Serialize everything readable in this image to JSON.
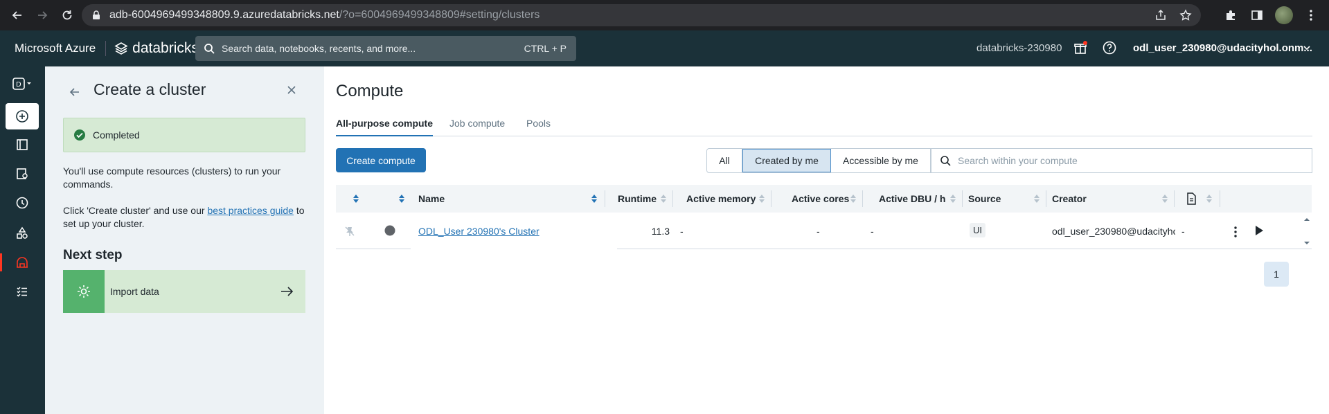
{
  "browser": {
    "url_host": "adb-6004969499348809.9.azuredatabricks.net",
    "url_rest": "/?o=6004969499348809#setting/clusters"
  },
  "topnav": {
    "brand": "Microsoft Azure",
    "product": "databricks",
    "search_placeholder": "Search data, notebooks, recents, and more...",
    "search_shortcut": "CTRL + P",
    "workspace": "databricks-230980",
    "user": "odl_user_230980@udacityhol.onm..."
  },
  "panel": {
    "title": "Create a cluster",
    "status": "Completed",
    "text1": "You'll use compute resources (clusters) to run your commands.",
    "text2_pre": "Click 'Create cluster' and use our ",
    "text2_link": "best practices guide",
    "text2_post": " to set up your cluster.",
    "next_step": "Next step",
    "import_label": "Import data"
  },
  "main": {
    "title": "Compute",
    "tabs": [
      "All-purpose compute",
      "Job compute",
      "Pools"
    ],
    "create_button": "Create compute",
    "filters": [
      "All",
      "Created by me",
      "Accessible by me"
    ],
    "selected_filter": "Created by me",
    "search_placeholder": "Search within your compute"
  },
  "table": {
    "columns": [
      "Name",
      "Runtime",
      "Active memory",
      "Active cores",
      "Active DBU / h",
      "Source",
      "Creator"
    ],
    "rows": [
      {
        "name": "ODL_User 230980's Cluster",
        "runtime": "11.3",
        "active_memory": "-",
        "active_cores": "-",
        "active_dbu": "-",
        "source": "UI",
        "creator": "odl_user_230980@udacityhc",
        "notebooks": "-"
      }
    ]
  },
  "pagination": {
    "current": "1"
  }
}
